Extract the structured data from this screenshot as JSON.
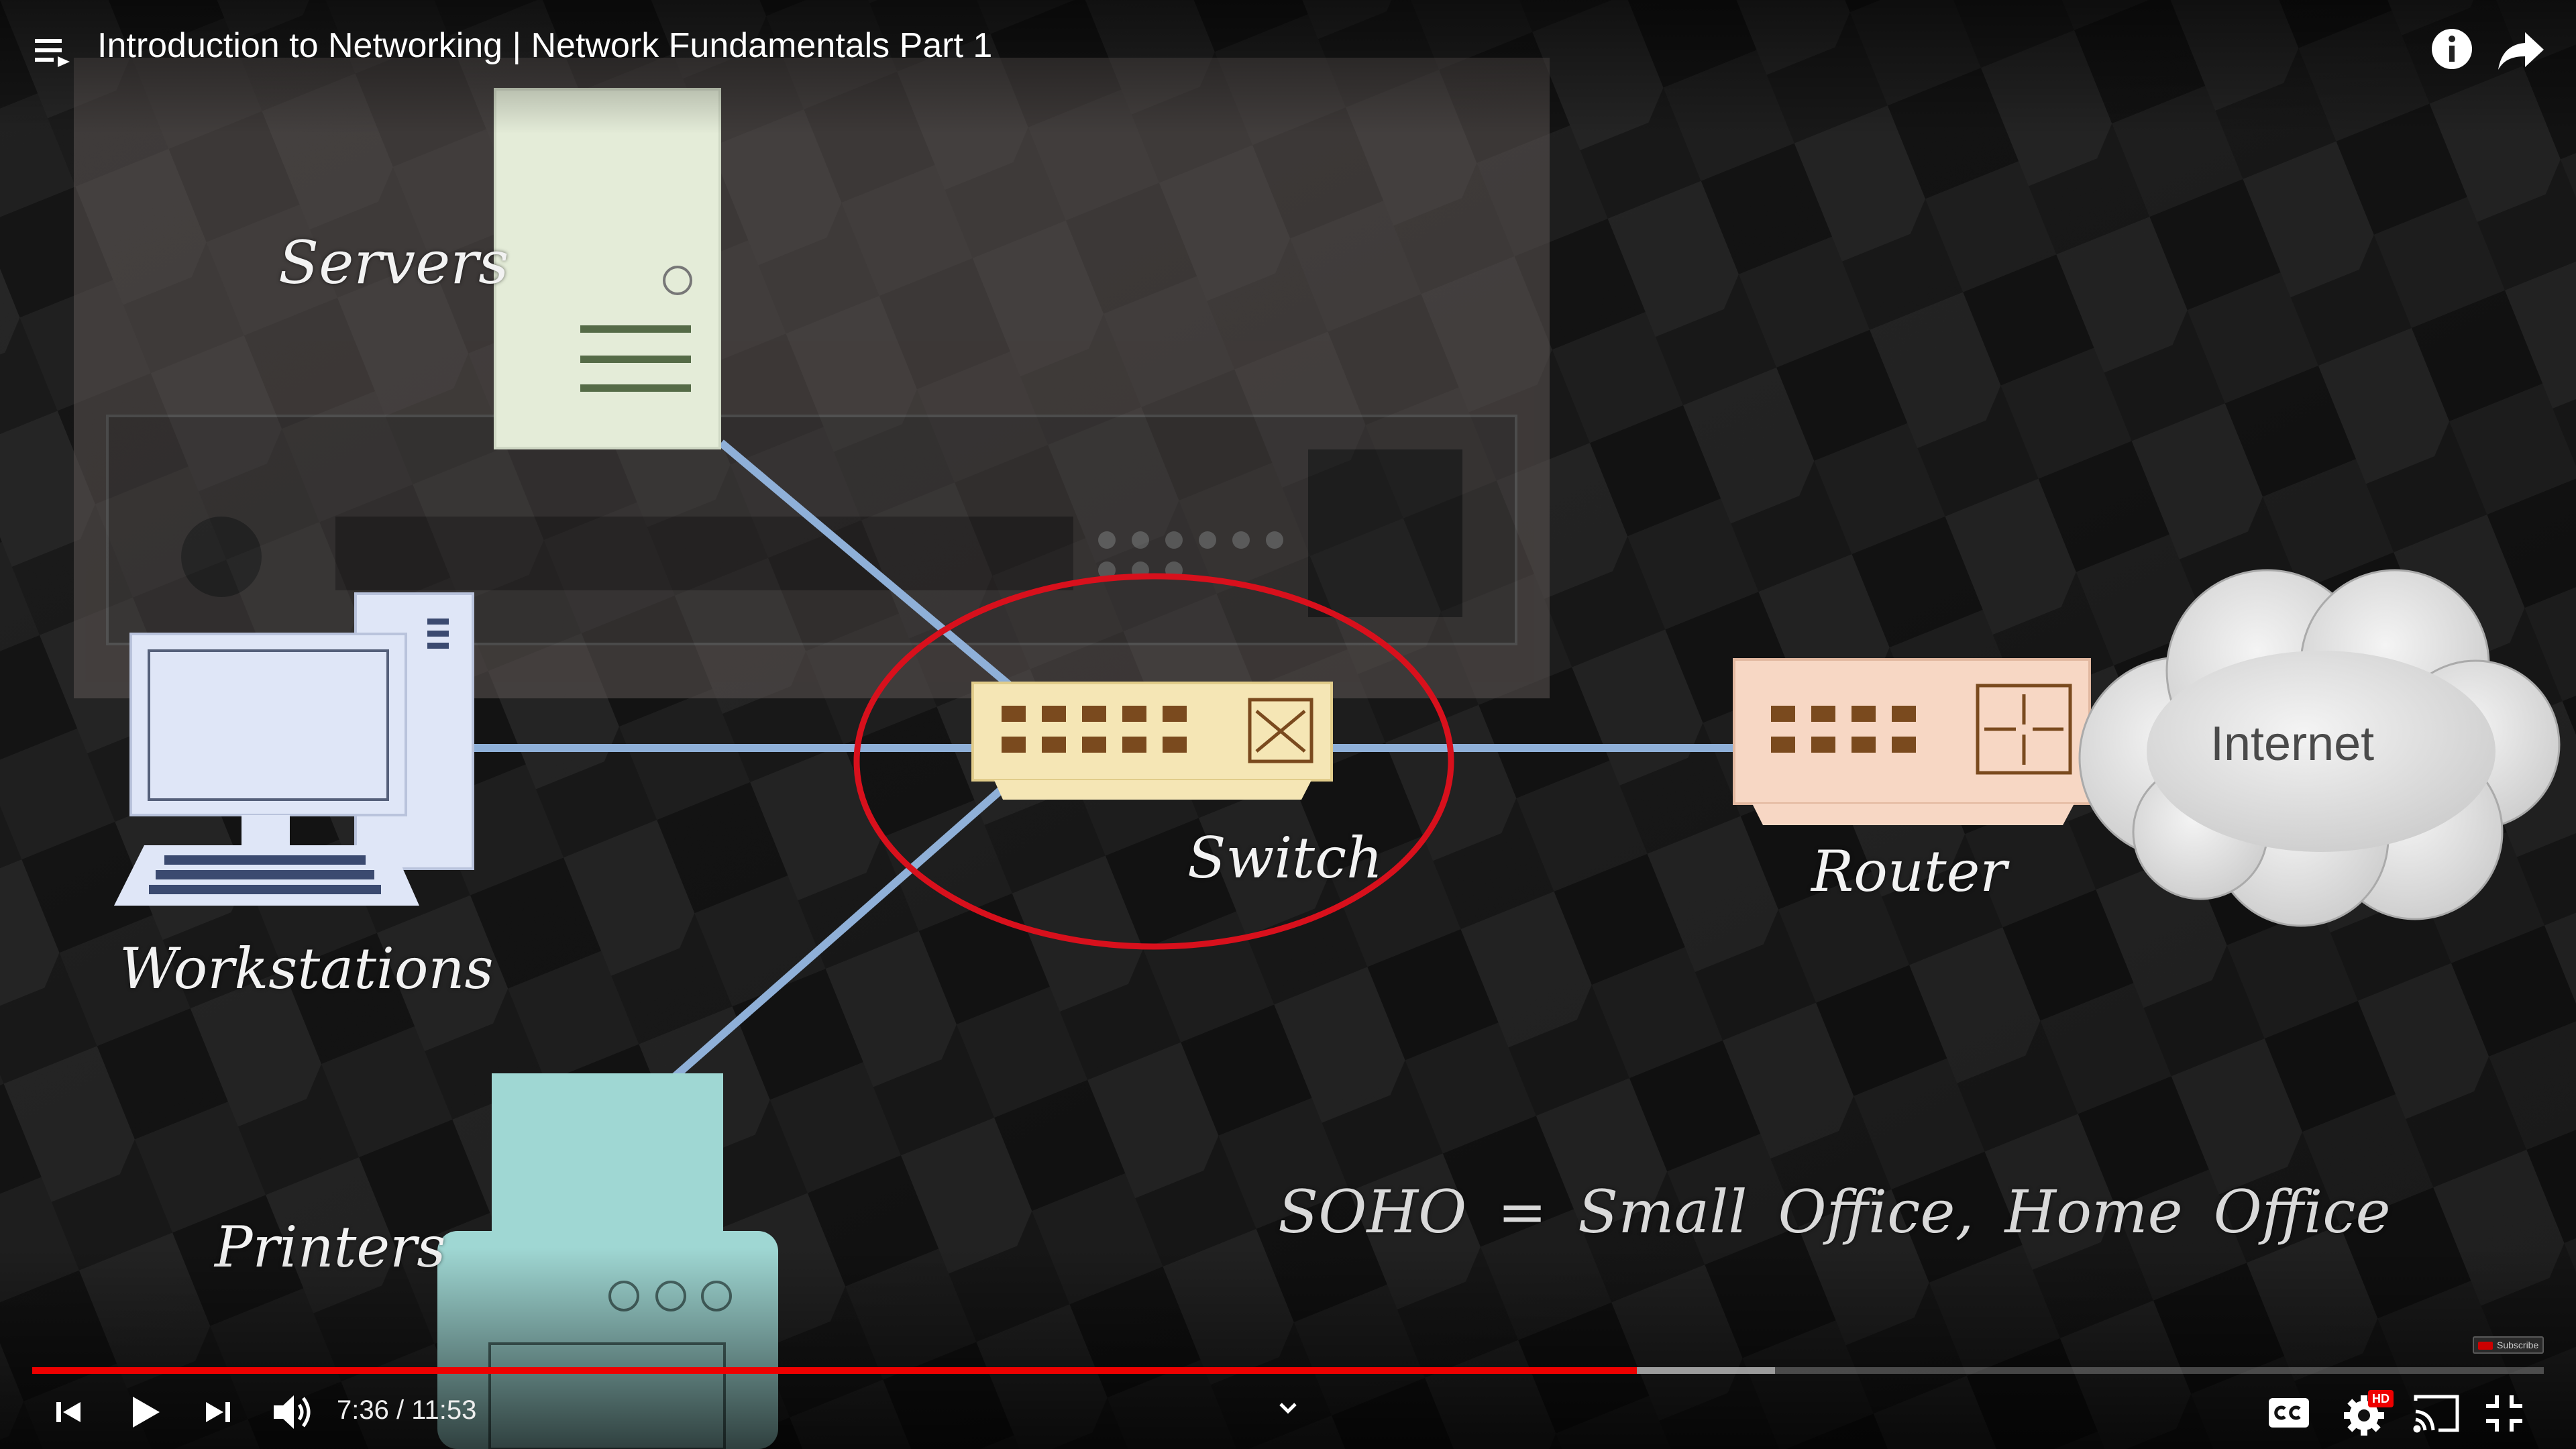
{
  "video": {
    "title": "Introduction to Networking | Network Fundamentals Part 1",
    "current_time": "7:36",
    "duration": "11:53",
    "time_display": "7:36 / 11:53",
    "played_fraction": 0.639,
    "buffered_fraction": 0.694
  },
  "slide": {
    "labels": {
      "servers": "Servers",
      "workstations": "Workstations",
      "printers": "Printers",
      "switch": "Switch",
      "router": "Router",
      "internet": "Internet",
      "soho": "SOHO = Small Office, Home Office"
    }
  },
  "colors": {
    "accent": "#e00000",
    "link_line": "#8fb0d8",
    "highlight_ellipse": "#d8101c",
    "server_fill": "#e4ecd8",
    "switch_fill": "#f5e6b5",
    "router_fill": "#f7d7c4",
    "printer_fill": "#9fd7d3",
    "workstation_fill": "#dfe6f7"
  },
  "icons": {
    "top_left": "playlist-icon",
    "top_right": [
      "info-icon",
      "share-icon"
    ],
    "controls_left": [
      "previous-icon",
      "play-icon",
      "next-icon",
      "volume-icon"
    ],
    "controls_right": [
      "captions-icon",
      "settings-icon",
      "cast-icon",
      "exit-fullscreen-icon"
    ]
  },
  "settings_badge": "HD",
  "watermark": "Subscribe"
}
